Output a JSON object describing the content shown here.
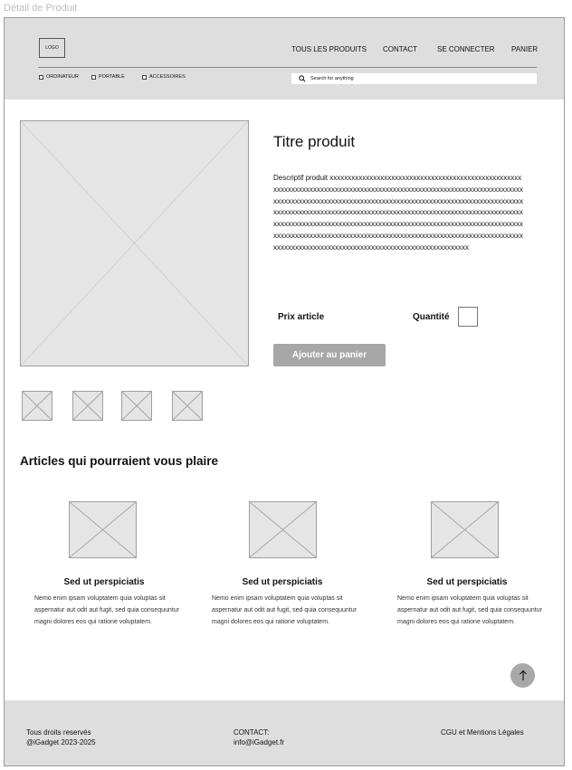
{
  "page_label": "Détail de Produit",
  "header": {
    "logo": "LOGO",
    "nav": [
      "TOUS LES PRODUITS",
      "CONTACT",
      "SE CONNECTER",
      "PANIER"
    ],
    "categories": [
      "ORDINATEUR",
      "PORTABLE",
      "ACCESSOIRES"
    ],
    "search_placeholder": "Search for anything"
  },
  "product": {
    "title": "Titre produit",
    "description": "Descriptif produit xxxxxxxxxxxxxxxxxxxxxxxxxxxxxxxxxxxxxxxxxxxxxxxxxxxxxxxxxxxxxxxxxxxxxxxxxxxxxxxxxxxxxxxxxxxxxxxxxxxxxxxxxxxxxxxxxxxxxxxxxxxxxxxxxxxxxxxxxxxxxxxxxxxxxxxxxxxxxxxxxxxxxxxxxxxxxxxxxxxxxxxxxxxxxxxxxxxxxxxxxxxxxxxxxxxxxxxxxxxxxxxxxxxxxxxxxxxxxxxxxxxxxxxxxxxxxxxxxxxxxxxxxxxxxxxxxxxxxxxxxxxxxxxxxxxxxxxxxxxxxxxxxxxxxxxxxxxxxxxxxxxxxxxxxxxxxxxxxxxxxxxxxxxxxxxxxxxxxxxxxxxxxxxxxxxxxxxxxxxxxxxxxxxxxxxxxxxxxxxxxxxxxxxxxxxxxxxxxxxxxxxxxxxxxxxxxxxxxxxxxxxxxxxxxxxx",
    "price_label": "Prix article",
    "quantity_label": "Quantité",
    "add_to_cart": "Ajouter au panier"
  },
  "related": {
    "heading": "Articles qui pourraient vous plaire",
    "items": [
      {
        "title": "Sed ut perspiciatis",
        "text": "Nemo enim ipsam voluptatem quia voluptas sit aspernatur aut odit aut fugit, sed quia consequuntur magni dolores eos qui ratione voluptatem."
      },
      {
        "title": "Sed ut perspiciatis",
        "text": "Nemo enim ipsam voluptatem quia voluptas sit aspernatur aut odit aut fugit, sed quia consequuntur magni dolores eos qui ratione voluptatem."
      },
      {
        "title": "Sed ut perspiciatis",
        "text": "Nemo enim ipsam voluptatem quia voluptas sit aspernatur aut odit aut fugit, sed quia consequuntur magni dolores eos qui ratione voluptatem."
      }
    ]
  },
  "footer": {
    "rights_line1": "Tous droits reservés",
    "rights_line2": "@iGadget 2023-2025",
    "contact_line1": "CONTACT:",
    "contact_line2": "info@iGadget.fr",
    "legal": "CGU et Mentions Légales"
  }
}
